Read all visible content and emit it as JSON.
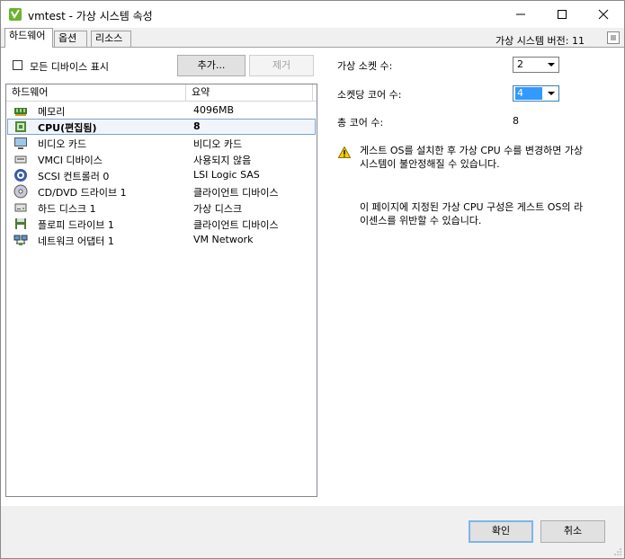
{
  "window": {
    "title": "vmtest - 가상 시스템 속성",
    "app_icon": "vsphere-logo-icon",
    "controls": [
      "minimize-icon",
      "maximize-icon",
      "close-icon"
    ]
  },
  "tabs": [
    {
      "label": "하드웨어",
      "active": true
    },
    {
      "label": "옵션",
      "active": false
    },
    {
      "label": "리소스",
      "active": false
    }
  ],
  "vm_version": "가상 시스템 버전: 11",
  "hardware": {
    "show_all_devices_label": "모든 디바이스 표시",
    "show_all_devices_checked": false,
    "add_button": "추가...",
    "remove_button": "제거",
    "columns": {
      "hardware": "하드웨어",
      "summary": "요약"
    },
    "rows": [
      {
        "name": "메모리",
        "summary": "4096MB",
        "icon": "memory-icon",
        "selected": false,
        "bold": false
      },
      {
        "name": "CPU(편집됨)",
        "summary": "8",
        "icon": "cpu-icon",
        "selected": true,
        "bold": true
      },
      {
        "name": "비디오 카드",
        "summary": "비디오 카드",
        "icon": "monitor-icon",
        "selected": false,
        "bold": false
      },
      {
        "name": "VMCI 디바이스",
        "summary": "사용되지 않음",
        "icon": "vmci-device-icon",
        "selected": false,
        "bold": false
      },
      {
        "name": "SCSI 컨트롤러 0",
        "summary": "LSI Logic SAS",
        "icon": "scsi-controller-icon",
        "selected": false,
        "bold": false
      },
      {
        "name": "CD/DVD 드라이브 1",
        "summary": "클라이언트 디바이스",
        "icon": "cd-dvd-icon",
        "selected": false,
        "bold": false
      },
      {
        "name": "하드 디스크 1",
        "summary": "가상 디스크",
        "icon": "hard-disk-icon",
        "selected": false,
        "bold": false
      },
      {
        "name": "플로피 드라이브 1",
        "summary": "클라이언트 디바이스",
        "icon": "floppy-icon",
        "selected": false,
        "bold": false
      },
      {
        "name": "네트워크 어댑터 1",
        "summary": "VM Network",
        "icon": "network-adapter-icon",
        "selected": false,
        "bold": false
      }
    ]
  },
  "cpu": {
    "sockets_label": "가상 소켓 수:",
    "sockets_value": "2",
    "cores_label": "소켓당 코어 수:",
    "cores_value": "4",
    "total_label": "총 코어 수:",
    "total_value": "8",
    "warning_line1": "게스트 OS를 설치한 후 가상 CPU 수를 변경하면 가상",
    "warning_line2": "시스템이 불안정해질 수 있습니다.",
    "license_line1": "이 페이지에 지정된 가상 CPU 구성은 게스트 OS의 라",
    "license_line2": "이센스를 위반할 수 있습니다."
  },
  "footer": {
    "ok_button": "확인",
    "cancel_button": "취소"
  },
  "colors": {
    "selection_border": "#7da2ce",
    "selection_fill": "#f1f5fb",
    "focus_highlight": "#3399ff",
    "default_button_border": "#7eb4ea"
  }
}
